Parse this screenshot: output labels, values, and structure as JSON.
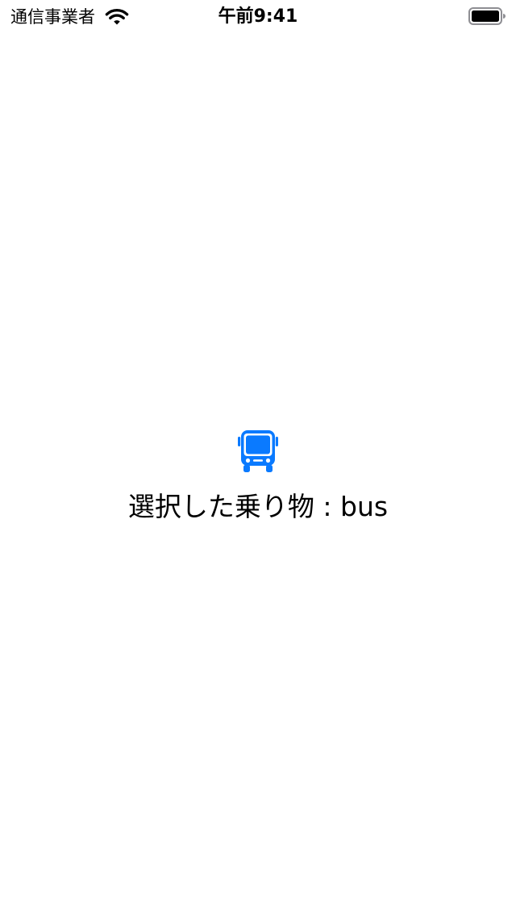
{
  "status_bar": {
    "carrier": "通信事業者",
    "time": "午前9:41",
    "wifi_icon": "wifi-icon",
    "battery_icon": "battery-full-icon",
    "battery_level_fraction": 1.0
  },
  "main": {
    "icon": "bus-icon",
    "icon_color": "#0A7AFF",
    "selection_label": "選択した乗り物 : bus"
  }
}
